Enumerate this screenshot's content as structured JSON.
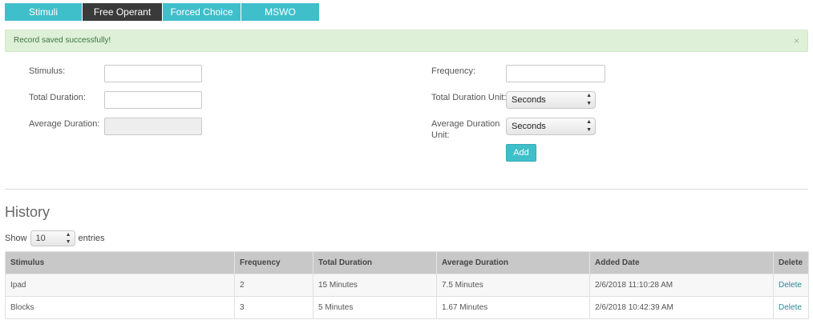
{
  "tabs": [
    {
      "label": "Stimuli"
    },
    {
      "label": "Free Operant"
    },
    {
      "label": "Forced Choice"
    },
    {
      "label": "MSWO"
    }
  ],
  "alert": {
    "message": "Record saved successfully!",
    "close": "×"
  },
  "form": {
    "stimulus_label": "Stimulus:",
    "total_duration_label": "Total Duration:",
    "average_duration_label": "Average Duration:",
    "frequency_label": "Frequency:",
    "total_duration_unit_label": "Total Duration Unit:",
    "average_duration_unit_label": "Average Duration Unit:",
    "total_duration_unit_value": "Seconds",
    "average_duration_unit_value": "Seconds",
    "add_label": "Add"
  },
  "history": {
    "title": "History",
    "show_label": "Show",
    "length_value": "10",
    "entries_label": "entries",
    "columns": [
      "Stimulus",
      "Frequency",
      "Total Duration",
      "Average Duration",
      "Added Date",
      "Delete"
    ],
    "rows": [
      {
        "stimulus": "Ipad",
        "frequency": "2",
        "total": "15 Minutes",
        "average": "7.5 Minutes",
        "date": "2/6/2018 11:10:28 AM",
        "action": "Delete"
      },
      {
        "stimulus": "Blocks",
        "frequency": "3",
        "total": "5 Minutes",
        "average": "1.67 Minutes",
        "date": "2/6/2018 10:42:39 AM",
        "action": "Delete"
      }
    ]
  },
  "colors": {
    "accent": "#3fbfca",
    "active_tab": "#3a3a3a",
    "alert_bg": "#dff0d8"
  }
}
